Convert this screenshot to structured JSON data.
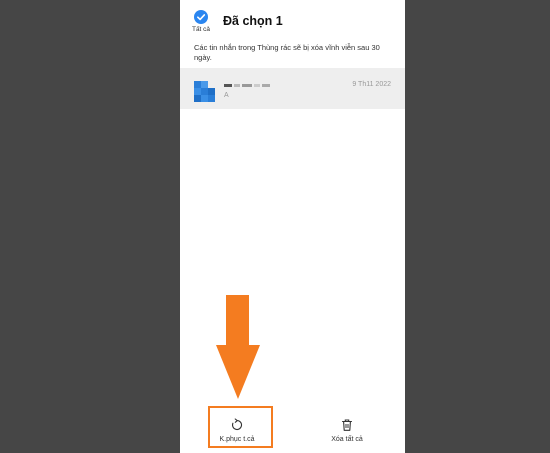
{
  "header": {
    "select_all_label": "Tất cả",
    "title": "Đã chọn 1"
  },
  "notice": "Các tin nhắn trong Thùng rác sẽ bị xóa vĩnh viễn sau 30 ngày.",
  "messages": [
    {
      "snippet": "A",
      "date": "9 Th11 2022",
      "selected": true
    }
  ],
  "toolbar": {
    "restore_label": "K.phục t.cả",
    "delete_label": "Xóa tất cả"
  },
  "colors": {
    "accent": "#2b86f0",
    "annotation": "#f47c20",
    "selected_row": "#eeeeee",
    "background": "#464646"
  },
  "icons": {
    "select_all": "check-circle-icon",
    "restore": "restore-icon",
    "delete": "trash-icon",
    "annotation": "down-arrow-icon"
  }
}
